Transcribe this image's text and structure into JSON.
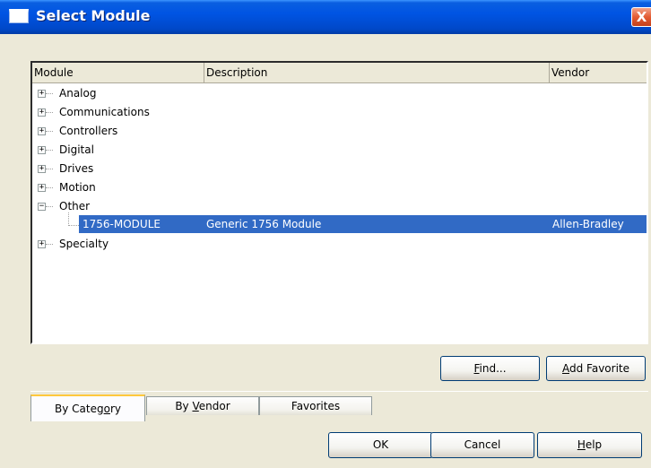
{
  "window": {
    "title": "Select Module",
    "close_label": "X"
  },
  "list": {
    "columns": [
      "Module",
      "Description",
      "Vendor"
    ],
    "tree": [
      {
        "label": "Analog",
        "expander": "+"
      },
      {
        "label": "Communications",
        "expander": "+"
      },
      {
        "label": "Controllers",
        "expander": "+"
      },
      {
        "label": "Digital",
        "expander": "+"
      },
      {
        "label": "Drives",
        "expander": "+"
      },
      {
        "label": "Motion",
        "expander": "+"
      },
      {
        "label": "Other",
        "expander": "−"
      },
      {
        "label": "Specialty",
        "expander": "+"
      }
    ],
    "selected": {
      "module": "1756-MODULE",
      "description": "Generic 1756 Module",
      "vendor": "Allen-Bradley"
    }
  },
  "actions": {
    "find_first": "F",
    "find_rest": "ind...",
    "add_fav_first": "A",
    "add_fav_rest": "dd Favorite"
  },
  "tabs": {
    "by_category_pre": "By Categ",
    "by_category_u": "o",
    "by_category_post": "ry",
    "by_vendor_pre": "By ",
    "by_vendor_u": "V",
    "by_vendor_post": "endor",
    "favorites": "Favorites"
  },
  "footer": {
    "ok": "OK",
    "cancel": "Cancel",
    "help_first": "H",
    "help_rest": "elp"
  },
  "colors": {
    "selection": "#316ac5",
    "titlebar": "#0054e3",
    "dialog_bg": "#ece9d8"
  },
  "icons": {
    "title": "window-icon",
    "close": "close-icon",
    "expand": "plus-box-icon",
    "collapse": "minus-box-icon"
  }
}
